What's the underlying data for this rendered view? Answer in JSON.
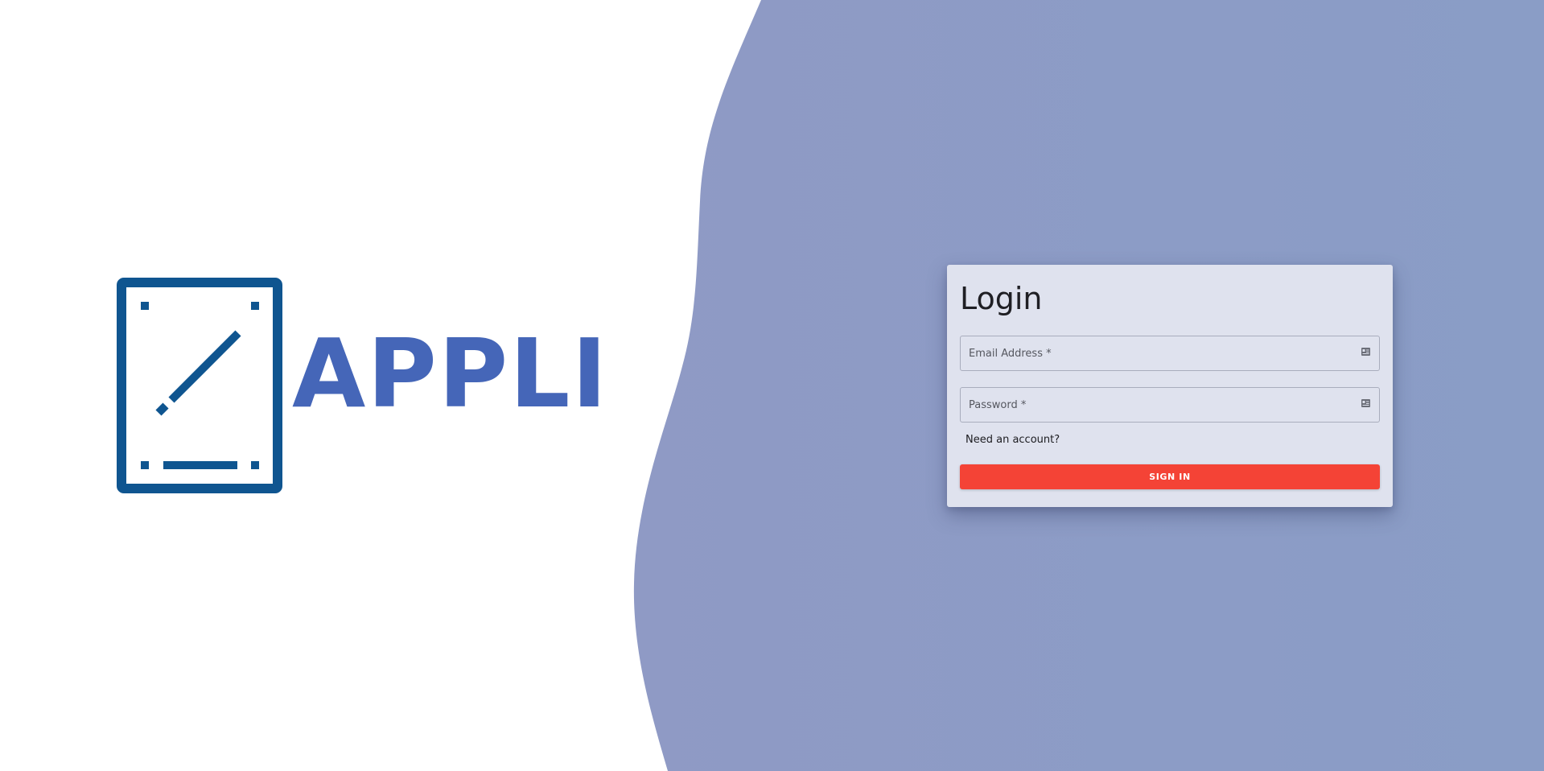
{
  "logo": {
    "word": "APPLI",
    "icon": "note-edit-icon",
    "color": "#0f5590",
    "word_color": "#4566b8"
  },
  "background": {
    "accent": "#8a9dc6"
  },
  "login": {
    "title": "Login",
    "email": {
      "placeholder": "Email Address *",
      "value": "",
      "icon": "id-card-icon"
    },
    "password": {
      "placeholder": "Password *",
      "value": "",
      "icon": "id-card-icon"
    },
    "account_link": "Need an account?",
    "submit_label": "SIGN IN",
    "submit_color": "#f44336",
    "card_color": "#dfe2ee"
  }
}
